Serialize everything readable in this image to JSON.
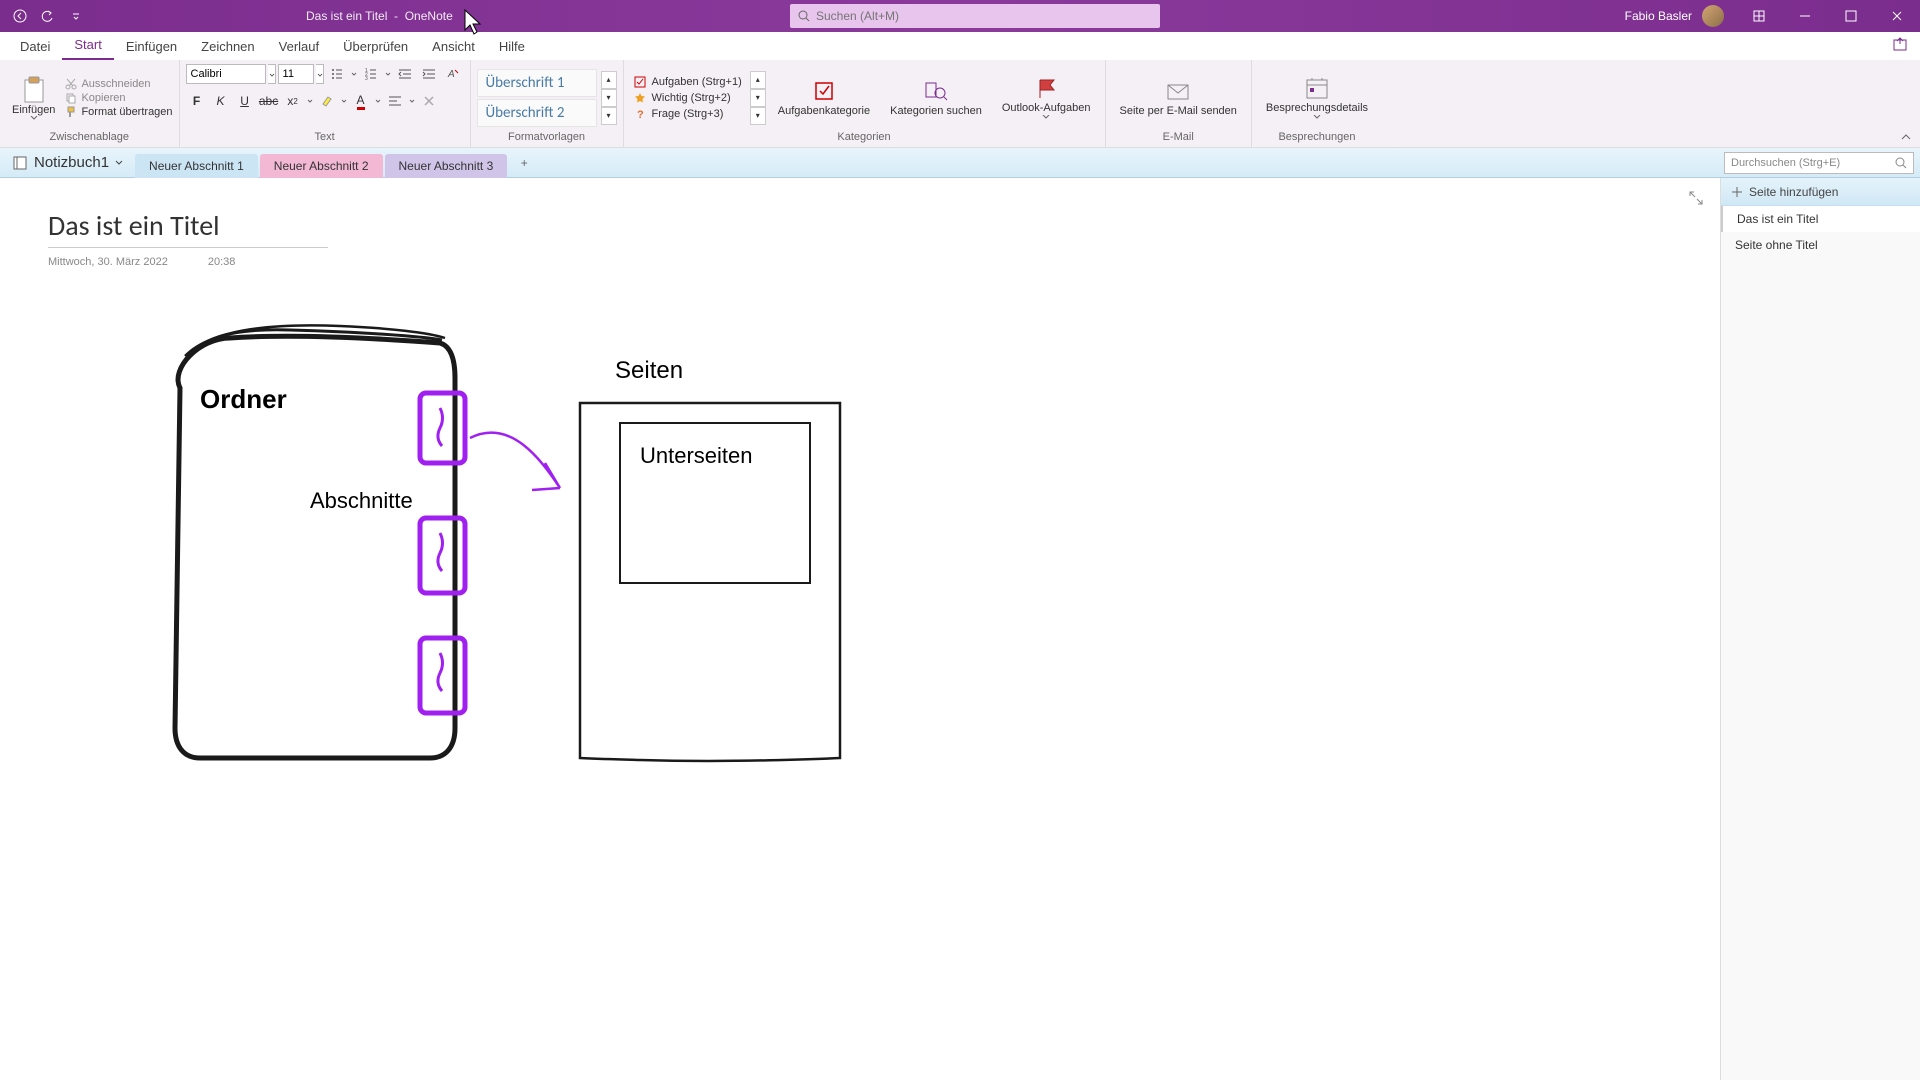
{
  "titlebar": {
    "doc_title": "Das ist ein Titel",
    "app_name": "OneNote",
    "search_placeholder": "Suchen (Alt+M)",
    "user_name": "Fabio Basler"
  },
  "menu": {
    "tabs": [
      "Datei",
      "Start",
      "Einfügen",
      "Zeichnen",
      "Verlauf",
      "Überprüfen",
      "Ansicht",
      "Hilfe"
    ],
    "active_index": 1
  },
  "ribbon": {
    "clipboard": {
      "label": "Zwischenablage",
      "paste": "Einfügen",
      "cut": "Ausschneiden",
      "copy": "Kopieren",
      "format_painter": "Format übertragen"
    },
    "text": {
      "label": "Text",
      "font_name": "Calibri",
      "font_size": "11"
    },
    "styles": {
      "label": "Formatvorlagen",
      "items": [
        "Überschrift 1",
        "Überschrift 2"
      ]
    },
    "tags": {
      "label": "Kategorien",
      "items": [
        {
          "name": "Aufgaben (Strg+1)",
          "icon": "checkbox"
        },
        {
          "name": "Wichtig (Strg+2)",
          "icon": "star"
        },
        {
          "name": "Frage (Strg+3)",
          "icon": "question"
        }
      ],
      "task_category": "Aufgabenkategorie",
      "find_tags": "Kategorien suchen",
      "outlook_tasks": "Outlook-Aufgaben"
    },
    "email": {
      "label": "E-Mail",
      "button": "Seite per E-Mail senden"
    },
    "meetings": {
      "label": "Besprechungen",
      "button": "Besprechungsdetails"
    }
  },
  "notebook": {
    "name": "Notizbuch1",
    "sections": [
      "Neuer Abschnitt 1",
      "Neuer Abschnitt 2",
      "Neuer Abschnitt 3"
    ],
    "search_placeholder": "Durchsuchen (Strg+E)"
  },
  "page": {
    "title": "Das ist ein Titel",
    "date": "Mittwoch, 30. März 2022",
    "time": "20:38",
    "drawing": {
      "ordner": "Ordner",
      "abschnitte": "Abschnitte",
      "seiten": "Seiten",
      "unterseiten": "Unterseiten"
    }
  },
  "pagelist": {
    "add_label": "Seite hinzufügen",
    "items": [
      "Das ist ein Titel",
      "Seite ohne Titel"
    ],
    "active_index": 0
  },
  "colors": {
    "accent": "#7b2d8e",
    "ink_purple": "#a020f0",
    "ink_black": "#1a1a1a"
  }
}
